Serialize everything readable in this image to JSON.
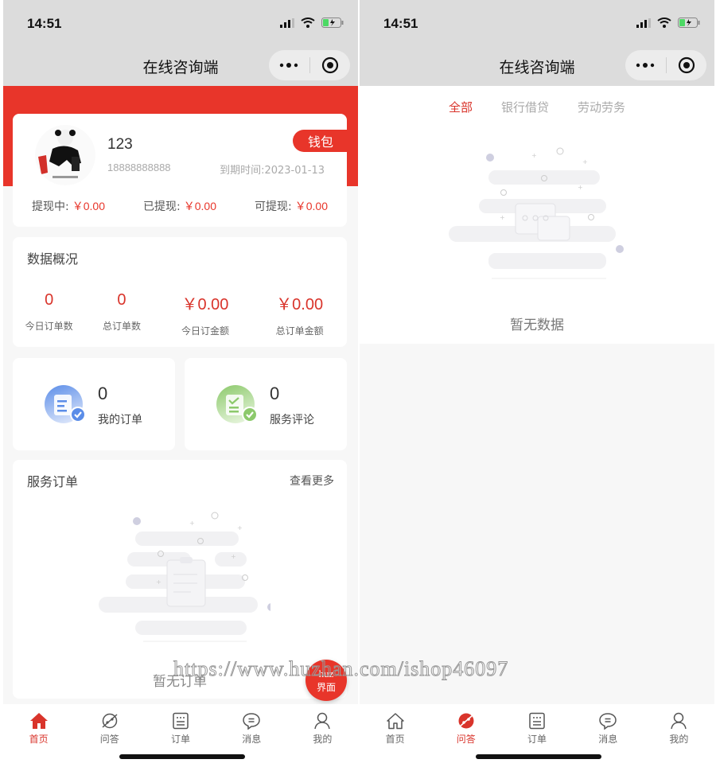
{
  "status_bar": {
    "time": "14:51"
  },
  "nav": {
    "title": "在线咨询端",
    "more_icon": "more-dots-icon",
    "close_icon": "target-circle-icon"
  },
  "home": {
    "profile": {
      "name": "123",
      "phone": "18888888888",
      "expire": "到期时间:2023-01-13",
      "wallet_button": "钱包"
    },
    "withdraw": [
      {
        "label": "提现中:",
        "amount": "￥0.00"
      },
      {
        "label": "已提现:",
        "amount": "￥0.00"
      },
      {
        "label": "可提现:",
        "amount": "￥0.00"
      }
    ],
    "overview": {
      "title": "数据概况",
      "stats": [
        {
          "value": "0",
          "label": "今日订单数"
        },
        {
          "value": "0",
          "label": "总订单数"
        },
        {
          "value": "￥0.00",
          "label": "今日订金额"
        },
        {
          "value": "￥0.00",
          "label": "总订单金额"
        }
      ]
    },
    "mini_cards": [
      {
        "count": "0",
        "label": "我的订单",
        "icon": "my-orders-icon",
        "color": "#5b8de8"
      },
      {
        "count": "0",
        "label": "服务评论",
        "icon": "service-review-icon",
        "color": "#8cc96b"
      }
    ],
    "service_orders": {
      "title": "服务订单",
      "more": "查看更多",
      "empty_text": "暂无订单"
    },
    "fab": {
      "line1": "huz",
      "line2": "界面"
    }
  },
  "qa": {
    "tabs": [
      {
        "label": "全部",
        "active": true
      },
      {
        "label": "银行借贷",
        "active": false
      },
      {
        "label": "劳动劳务",
        "active": false
      }
    ],
    "empty_text": "暂无数据"
  },
  "tabbar": [
    {
      "label": "首页",
      "icon": "home-icon"
    },
    {
      "label": "问答",
      "icon": "qa-planet-icon"
    },
    {
      "label": "订单",
      "icon": "order-list-icon"
    },
    {
      "label": "消息",
      "icon": "message-bubble-icon"
    },
    {
      "label": "我的",
      "icon": "profile-person-icon"
    }
  ],
  "tabbar_active": {
    "left": 0,
    "right": 1
  },
  "watermark": "https://www.huzhan.com/ishop46097",
  "colors": {
    "accent": "#e8352a",
    "accent_text": "#d9342b",
    "topbar": "#dcdcdc",
    "page_bg": "#f7f7f7"
  }
}
